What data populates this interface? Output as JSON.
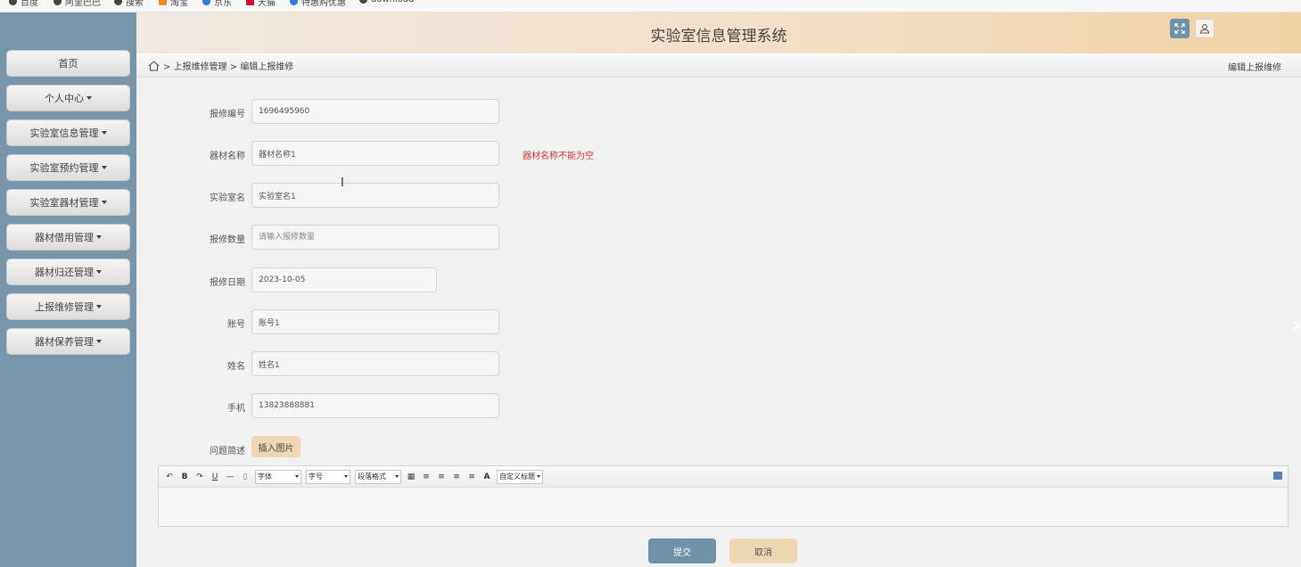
{
  "bookmarks": [
    "百度",
    "阿里巴巴",
    "搜索",
    "淘宝",
    "京东",
    "天猫",
    "特惠购优惠",
    "download"
  ],
  "sidebar": {
    "items": [
      {
        "label": "首页",
        "has_dropdown": false
      },
      {
        "label": "个人中心",
        "has_dropdown": true
      },
      {
        "label": "实验室信息管理",
        "has_dropdown": true
      },
      {
        "label": "实验室预约管理",
        "has_dropdown": true
      },
      {
        "label": "实验室器材管理",
        "has_dropdown": true
      },
      {
        "label": "器材借用管理",
        "has_dropdown": true
      },
      {
        "label": "器材归还管理",
        "has_dropdown": true
      },
      {
        "label": "上报维修管理",
        "has_dropdown": true
      },
      {
        "label": "器材保养管理",
        "has_dropdown": true
      }
    ]
  },
  "header": {
    "title": "实验室信息管理系统",
    "fullscreen_icon": "expand-icon",
    "user_icon": "user-icon"
  },
  "breadcrumb": {
    "home_icon": "home-icon",
    "path": "> 上报维修管理 > 编辑上报维修",
    "right_title": "编辑上报维修"
  },
  "form": {
    "fields": [
      {
        "label": "报修编号",
        "value": "1696495960",
        "placeholder": ""
      },
      {
        "label": "器材名称",
        "value": "器材名称1",
        "placeholder": ""
      },
      {
        "label": "实验室名",
        "value": "实验室名1",
        "placeholder": ""
      },
      {
        "label": "报修数量",
        "value": "",
        "placeholder": "请输入报修数量"
      },
      {
        "label": "报修日期",
        "value": "2023-10-05",
        "placeholder": ""
      },
      {
        "label": "账号",
        "value": "账号1",
        "placeholder": ""
      },
      {
        "label": "姓名",
        "value": "姓名1",
        "placeholder": ""
      },
      {
        "label": "手机",
        "value": "13823888881",
        "placeholder": ""
      }
    ],
    "error_message": "器材名称不能为空",
    "description_label": "问题简述",
    "insert_image_label": "插入图片",
    "toolbar": {
      "font_select": "字体",
      "size_select": "字号",
      "paragraph_select": "段落格式",
      "custom_title_select": "自定义标题"
    },
    "submit_label": "提交",
    "cancel_label": "取消"
  },
  "colors": {
    "sidebar_bg": "#7796ab",
    "accent_blue": "#6e92a8",
    "accent_tan": "#f0d7b4",
    "error_red": "#d0392f"
  }
}
